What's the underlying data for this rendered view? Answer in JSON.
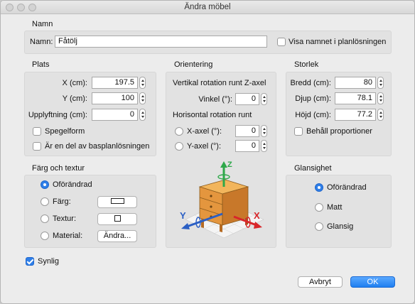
{
  "window": {
    "title": "Ändra möbel"
  },
  "namn": {
    "section_title": "Namn",
    "label": "Namn:",
    "value": "Fåtölj",
    "visa_label": "Visa namnet i planlösningen",
    "visa_checked": false
  },
  "plats": {
    "section_title": "Plats",
    "x_label": "X (cm):",
    "x_value": "197.5",
    "y_label": "Y (cm):",
    "y_value": "100",
    "upp_label": "Upplyftning (cm):",
    "upp_value": "0",
    "spegel_label": "Spegelform",
    "spegel_checked": false,
    "bas_label": "Är en del av basplanlösningen",
    "bas_checked": false
  },
  "orientering": {
    "section_title": "Orientering",
    "vertikal_label": "Vertikal rotation runt Z-axel",
    "vinkel_label": "Vinkel (°):",
    "vinkel_value": "0",
    "horisontal_label": "Horisontal rotation runt",
    "xaxel_label": "X-axel (°):",
    "xaxel_value": "0",
    "yaxel_label": "Y-axel (°):",
    "yaxel_value": "0",
    "axis_z": "Z",
    "axis_x": "X",
    "axis_y": "Y"
  },
  "storlek": {
    "section_title": "Storlek",
    "bredd_label": "Bredd (cm):",
    "bredd_value": "80",
    "djup_label": "Djup (cm):",
    "djup_value": "78.1",
    "hojd_label": "Höjd (cm):",
    "hojd_value": "77.2",
    "behall_label": "Behåll proportioner",
    "behall_checked": false
  },
  "farg": {
    "section_title": "Färg och textur",
    "oforandrad_label": "Oförändrad",
    "farg_label": "Färg:",
    "textur_label": "Textur:",
    "material_label": "Material:",
    "andra_label": "Ändra...",
    "selected": "Oförändrad"
  },
  "glansighet": {
    "section_title": "Glansighet",
    "oforandrad_label": "Oförändrad",
    "matt_label": "Matt",
    "glansig_label": "Glansig",
    "selected": "Oförändrad"
  },
  "synlig": {
    "label": "Synlig",
    "checked": true
  },
  "buttons": {
    "cancel": "Avbryt",
    "ok": "OK"
  },
  "colors": {
    "accent": "#2f7fe8",
    "axis_x": "#d8262a",
    "axis_y": "#2b5fc4",
    "axis_z": "#2ea84a"
  }
}
